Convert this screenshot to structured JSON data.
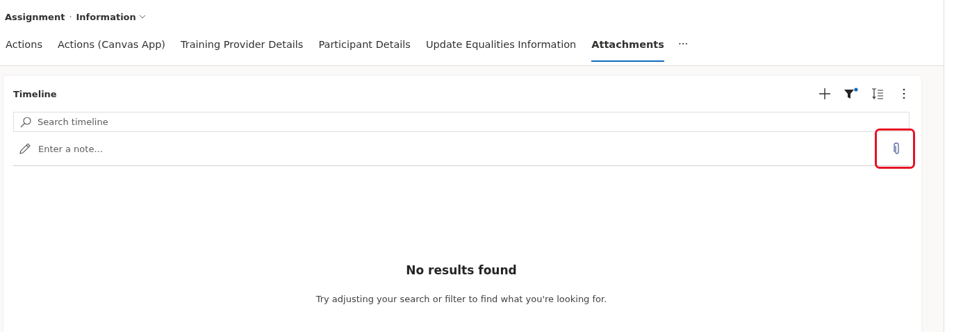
{
  "header": {
    "entity": "Assignment",
    "separator": "·",
    "form": "Information"
  },
  "tabs": [
    {
      "label": "Actions",
      "selected": false
    },
    {
      "label": "Actions (Canvas App)",
      "selected": false
    },
    {
      "label": "Training Provider Details",
      "selected": false
    },
    {
      "label": "Participant Details",
      "selected": false
    },
    {
      "label": "Update Equalities Information",
      "selected": false
    },
    {
      "label": "Attachments",
      "selected": true
    }
  ],
  "more_tabs": "···",
  "timeline": {
    "title": "Timeline",
    "filter_active": true,
    "search": {
      "placeholder": "Search timeline"
    },
    "note": {
      "placeholder": "Enter a note..."
    },
    "attach_highlighted": true,
    "empty": {
      "title": "No results found",
      "message": "Try adjusting your search or filter to find what you're looking for."
    }
  }
}
